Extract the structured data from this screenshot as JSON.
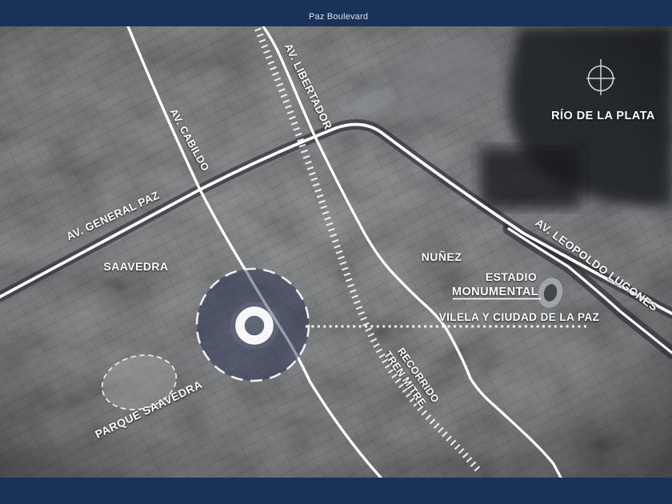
{
  "frame": {
    "top_label": "Paz Boulevard",
    "border_color": "#1a3158"
  },
  "map": {
    "labels": {
      "av_libertador": "AV. LIBERTADOR",
      "av_cabildo": "AV. CABILDO",
      "av_general_paz": "AV. GENERAL PAZ",
      "av_leopoldo_lugones": "AV. LEOPOLDO LUGONES",
      "rio_de_la_plata": "RÍO DE LA PLATA",
      "saavedra": "SAAVEDRA",
      "nunez": "NUÑEZ",
      "estadio_line1": "ESTADIO",
      "estadio_line2": "MONUMENTAL",
      "vilela": "VILELA Y CIUDAD DE LA PAZ",
      "recorrido_line1": "RECORRIDO",
      "recorrido_line2": "TREN MITRE",
      "parque_saavedra": "PARQUE SAAVEDRA"
    },
    "icons": {
      "compass": "crosshair-circle-compass",
      "station_ring": "white-ring-marker",
      "focus_area": "dashed-circle-highlight",
      "park_area": "dashed-ellipse-highlight",
      "railway": "tick-dash-rail-line",
      "boundary": "dotted-line"
    },
    "colors": {
      "border": "#1a3158",
      "label": "#ffffff",
      "road": "#fdfdfd",
      "focus_fill": "rgba(28,40,78,0.45)",
      "water": "#26292d",
      "satellite_base": "#3a3d41"
    }
  }
}
